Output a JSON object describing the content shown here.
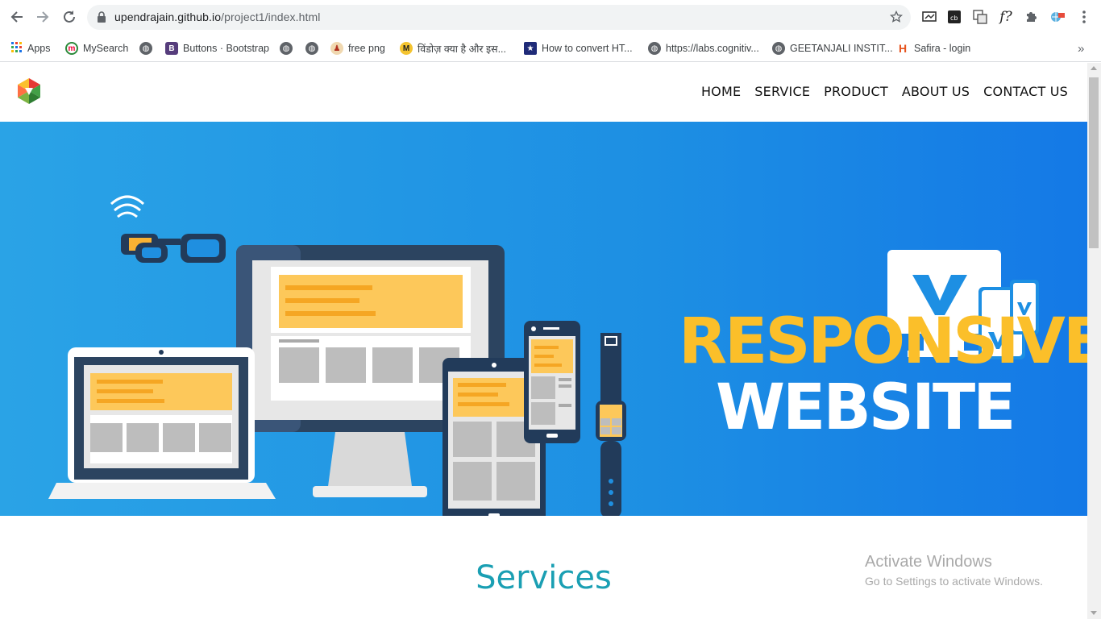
{
  "browser": {
    "url_host": "upendrajain.github.io",
    "url_path": "/project1/index.html",
    "icons": {
      "back": "back-arrow-icon",
      "forward": "forward-arrow-icon",
      "reload": "reload-icon",
      "lock": "lock-icon",
      "star": "star-icon",
      "menu": "kebab-menu-icon"
    },
    "bookmarks": [
      {
        "label": "Apps",
        "icon": "apps-grid-icon"
      },
      {
        "label": "MySearch",
        "icon": "mysearch-icon"
      },
      {
        "label": "",
        "icon": "globe-icon"
      },
      {
        "label": "Buttons · Bootstrap",
        "icon": "bootstrap-icon"
      },
      {
        "label": "",
        "icon": "globe-icon"
      },
      {
        "label": "",
        "icon": "globe-icon"
      },
      {
        "label": "free png",
        "icon": "pngitem-icon"
      },
      {
        "label": "विंडोज़ क्या है और इस...",
        "icon": "mobile-icon"
      },
      {
        "label": "How to convert HT...",
        "icon": "flag-icon"
      },
      {
        "label": "https://labs.cognitiv...",
        "icon": "globe-icon"
      },
      {
        "label": "GEETANJALI INSTIT...",
        "icon": "globe-icon"
      },
      {
        "label": "Safira - login",
        "icon": "safira-icon"
      }
    ],
    "overflow": "»"
  },
  "site": {
    "nav": {
      "logo": "site-logo-icon",
      "items": [
        "HOME",
        "SERVICE",
        "PRODUCT",
        "ABOUT US",
        "CONTACT US"
      ]
    },
    "hero": {
      "title": "RESPONSIVE",
      "subtitle": "WEBSITE",
      "colors": {
        "bg": "#1d8fe3",
        "accent": "#fbbf2a",
        "white": "#ffffff"
      }
    },
    "section_title": "Services"
  },
  "watermark": {
    "line1": "Activate Windows",
    "line2": "Go to Settings to activate Windows."
  }
}
